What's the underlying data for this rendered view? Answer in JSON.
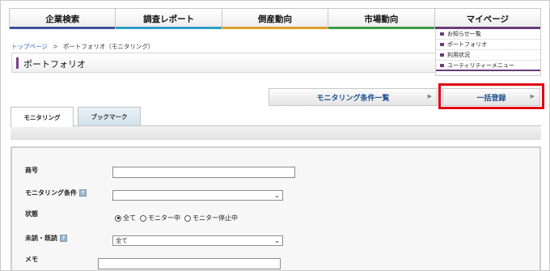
{
  "nav": {
    "items": [
      {
        "label": "企業検索",
        "color": "#3f4f9a"
      },
      {
        "label": "調査レポート",
        "color": "#2f9ec4"
      },
      {
        "label": "倒産動向",
        "color": "#d8a02a"
      },
      {
        "label": "市場動向",
        "color": "#3e9a44"
      },
      {
        "label": "マイページ",
        "color": "#6a3d7a"
      }
    ]
  },
  "mypage_menu": {
    "items": [
      "お知らせ一覧",
      "ポートフォリオ",
      "利用状況",
      "ユーティリティーメニュー"
    ]
  },
  "breadcrumb": {
    "home": "トップページ",
    "separator": ">",
    "current": "ポートフォリオ（モニタリング）"
  },
  "page": {
    "title": "ポートフォリオ"
  },
  "actions": {
    "list_label": "モニタリング条件一覧",
    "bulk_label": "一括登録"
  },
  "tabs": {
    "monitoring": "モニタリング",
    "bookmark": "ブックマーク"
  },
  "form": {
    "trade_name_label": "商号",
    "trade_name_value": "",
    "condition_label": "モニタリング条件",
    "condition_value": "",
    "status_label": "状態",
    "status_options": [
      "全て",
      "モニター中",
      "モニター停止中"
    ],
    "status_selected": "全て",
    "read_label": "未読・既読",
    "read_value": "全て",
    "memo_label": "メモ",
    "memo_value": ""
  },
  "colors": {
    "accent_purple": "#6a3d7a",
    "link_blue": "#2a62b0",
    "highlight_red": "#e00010"
  }
}
